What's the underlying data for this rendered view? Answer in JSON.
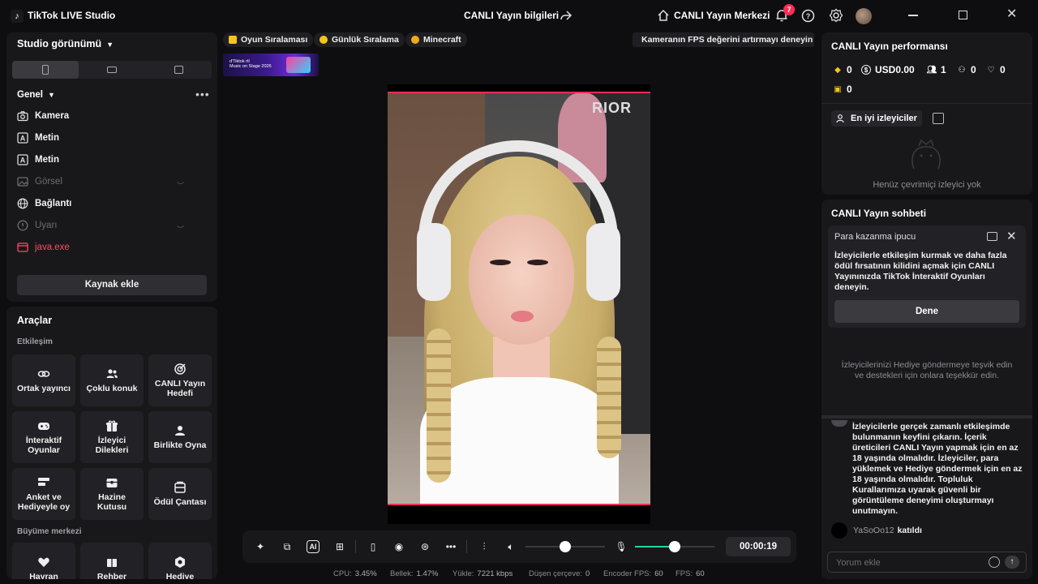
{
  "app": {
    "title": "TikTok LIVE Studio"
  },
  "header": {
    "stream_info": "CANLI Yayın bilgileri",
    "live_center": "CANLI Yayın Merkezi",
    "notification_count": "7"
  },
  "left": {
    "studio_view": "Studio görünümü",
    "group": "Genel",
    "sources": [
      {
        "label": "Kamera",
        "icon": "camera-icon"
      },
      {
        "label": "Metin",
        "icon": "text-icon"
      },
      {
        "label": "Metin",
        "icon": "text-icon"
      },
      {
        "label": "Görsel",
        "icon": "image-icon"
      },
      {
        "label": "Bağlantı",
        "icon": "globe-icon"
      },
      {
        "label": "Uyarı",
        "icon": "alert-icon"
      },
      {
        "label": "java.exe",
        "icon": "window-icon"
      }
    ],
    "add_source": "Kaynak ekle",
    "tools_title": "Araçlar",
    "interaction": "Etkileşim",
    "growth": "Büyüme merkezi",
    "tools": [
      "Ortak yayıncı",
      "Çoklu konuk",
      "CANLI Yayın\nHedefi",
      "İnteraktif\nOyunlar",
      "İzleyici\nDilekleri",
      "Birlikte Oyna",
      "Anket ve\nHediyeyle oy",
      "Hazine\nKutusu",
      "Ödül Çantası",
      "Hayran",
      "Rehber",
      "Hediye"
    ]
  },
  "center": {
    "pills": [
      "Oyun Sıralaması",
      "Günlük Sıralama",
      "Minecraft"
    ],
    "pill_colors": [
      "#f5c518",
      "#f5c518",
      "#f0a91b"
    ],
    "thumb_text": "d'Tiktok rtl\nMusic on Stage 2026",
    "fps_tip": "Kameranın FPS değerini artırmayı deneyin",
    "poster_text": "RIOR",
    "timer": "00:00:19",
    "volume_level": 0.5,
    "mic_level": 0.5,
    "stats": {
      "cpu_label": "CPU:",
      "cpu": "3.45%",
      "mem_label": "Bellek:",
      "mem": "1.47%",
      "upload_label": "Yükle:",
      "upload": "7221 kbps",
      "drop_label": "Düşen çerçeve:",
      "drop": "0",
      "enc_label": "Encoder FPS:",
      "enc": "60",
      "fps_label": "FPS:",
      "fps": "60"
    }
  },
  "right": {
    "perf_title": "CANLI Yayın performansı",
    "diamonds": "0",
    "usd": "USD0.00",
    "viewers": "1",
    "followers": "0",
    "likes": "0",
    "gifts": "0",
    "top_viewers": "En iyi izleyiciler",
    "no_viewers": "Henüz çevrimiçi izleyici yok",
    "chat_title": "CANLI Yayın sohbeti",
    "tip_title": "Para kazanma ipucu",
    "tip_body": "İzleyicilerle etkileşim kurmak ve daha fazla ödül fırsatının kilidini açmak için CANLI Yayınınızda TikTok İnteraktif Oyunları deneyin.",
    "tip_button": "Dene",
    "encourage": "İzleyicilerinizi Hediye göndermeye teşvik edin ve destekleri için onlara teşekkür edin.",
    "system_message": "İzleyicilerle gerçek zamanlı etkileşimde bulunmanın keyfini çıkarın. İçerik üreticileri CANLI Yayın yapmak için en az 18 yaşında olmalıdır. İzleyiciler, para yüklemek ve Hediye göndermek için en az 18 yaşında olmalıdır. Topluluk Kurallarımıza uyarak güvenli bir görüntüleme deneyimi oluşturmayı unutmayın.",
    "join_user": "YaSoOo12",
    "join_text": "katıldı",
    "chat_placeholder": "Yorum ekle"
  }
}
